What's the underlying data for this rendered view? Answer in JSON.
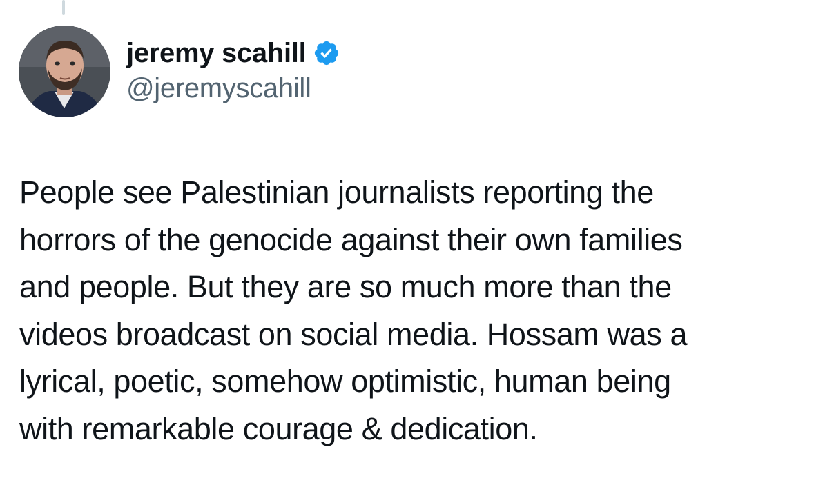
{
  "tweet": {
    "author": {
      "display_name": "jeremy scahill",
      "handle": "@jeremyscahill",
      "verified": true,
      "verified_color": "#1d9bf0",
      "avatar_icon": "profile-photo"
    },
    "text_lines": [
      "People see Palestinian journalists reporting the",
      "horrors of the genocide against their own families",
      "and people. But they are so much more than the",
      "videos broadcast on social media. Hossam was a",
      "lyrical, poetic, somehow optimistic, human being",
      "with remarkable courage & dedication."
    ]
  },
  "colors": {
    "text_primary": "#0f1419",
    "text_secondary": "#536471",
    "thread_line": "#cfd9de"
  }
}
